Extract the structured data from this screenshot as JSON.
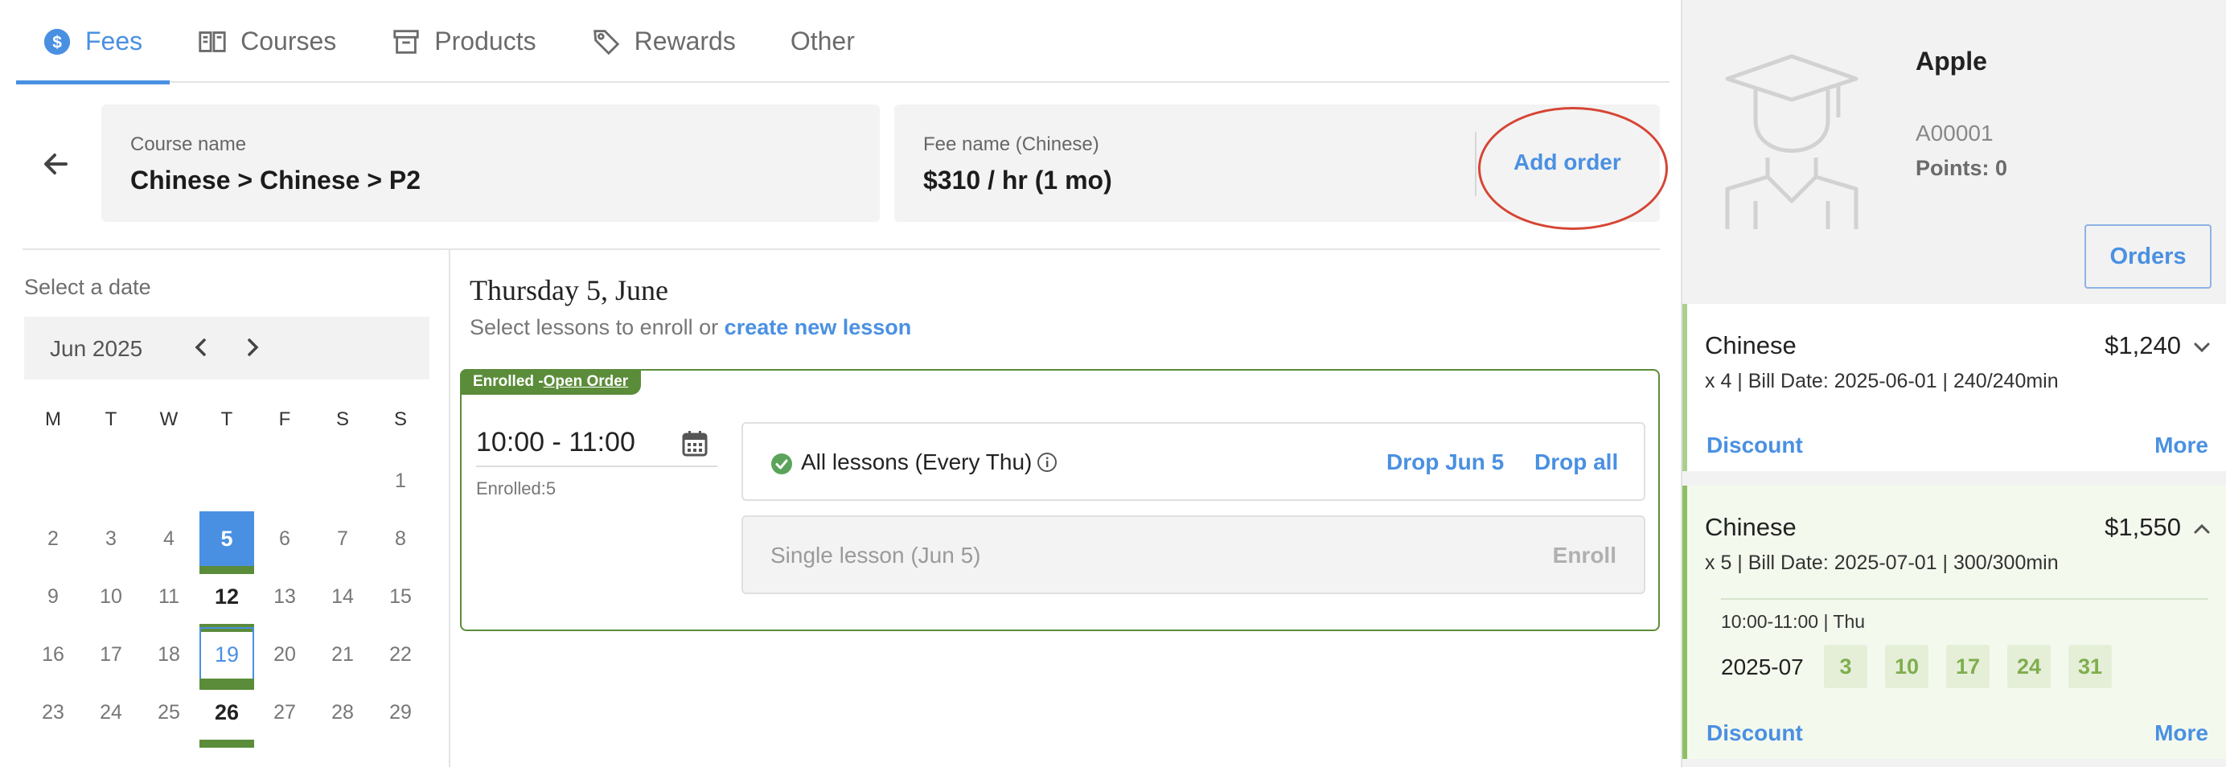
{
  "tabs": [
    {
      "label": "Fees",
      "icon": "dollar-circle-icon",
      "active": true
    },
    {
      "label": "Courses",
      "icon": "book-icon",
      "active": false
    },
    {
      "label": "Products",
      "icon": "archive-box-icon",
      "active": false
    },
    {
      "label": "Rewards",
      "icon": "tag-icon",
      "active": false
    },
    {
      "label": "Other",
      "icon": "",
      "active": false
    }
  ],
  "course_card": {
    "label": "Course name",
    "value": "Chinese > Chinese > P2"
  },
  "fee_card": {
    "label": "Fee name (Chinese)",
    "value": "$310 / hr (1 mo)",
    "action": "Add order"
  },
  "calendar": {
    "title": "Select a date",
    "month": "Jun 2025",
    "weekdays": [
      "M",
      "T",
      "W",
      "T",
      "F",
      "S",
      "S"
    ],
    "days": [
      "",
      "",
      "",
      "",
      "",
      "",
      "1",
      "2",
      "3",
      "4",
      "5",
      "6",
      "7",
      "8",
      "9",
      "10",
      "11",
      "12",
      "13",
      "14",
      "15",
      "16",
      "17",
      "18",
      "19",
      "20",
      "21",
      "22",
      "23",
      "24",
      "25",
      "26",
      "27",
      "28",
      "29"
    ],
    "selected_day": "5",
    "today_day": "19",
    "lesson_days": [
      "5",
      "12",
      "19",
      "26"
    ]
  },
  "lesson": {
    "date_heading": "Thursday 5, June",
    "subtitle_prefix": "Select lessons to enroll or",
    "create_link": "create new lesson",
    "tag_prefix": "Enrolled -",
    "tag_link": "Open Order",
    "time": "10:00 - 11:00",
    "enrolled": "Enrolled:5",
    "all_label": "All lessons (Every Thu)",
    "drop_one": "Drop Jun 5",
    "drop_all": "Drop all",
    "single_label": "Single lesson (Jun 5)",
    "enroll": "Enroll"
  },
  "student": {
    "name": "Apple",
    "id": "A00001",
    "points": "Points: 0",
    "orders_button": "Orders"
  },
  "orders": [
    {
      "title": "Chinese",
      "price": "$1,240",
      "details": "x 4 | Bill Date: 2025-06-01 | 240/240min",
      "discount": "Discount",
      "more": "More",
      "expanded": false
    },
    {
      "title": "Chinese",
      "price": "$1,550",
      "details": "x 5 | Bill Date: 2025-07-01 | 300/300min",
      "discount": "Discount",
      "more": "More",
      "expanded": true,
      "schedule": "10:00-11:00 | Thu",
      "month": "2025-07",
      "dates": [
        "3",
        "10",
        "17",
        "24",
        "31"
      ]
    }
  ],
  "colors": {
    "accent": "#4a90e2",
    "enrolled_green": "#5b8c3a",
    "highlight_red": "#d64534"
  }
}
